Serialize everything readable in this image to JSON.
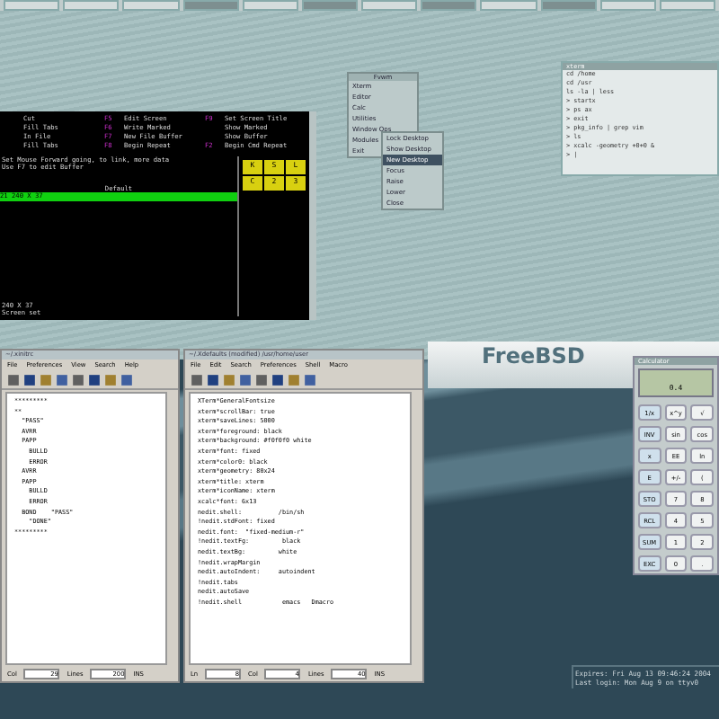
{
  "taskbar": {
    "buttons": [
      {
        "selected": false
      },
      {
        "selected": false
      },
      {
        "selected": false
      },
      {
        "selected": true
      },
      {
        "selected": false
      },
      {
        "selected": true
      },
      {
        "selected": false
      },
      {
        "selected": true
      },
      {
        "selected": false
      },
      {
        "selected": true
      },
      {
        "selected": false
      },
      {
        "selected": false
      }
    ]
  },
  "terminal": {
    "function_keys": [
      {
        "label": "Cut"
      },
      {
        "key": "F5",
        "label": "Edit Screen"
      },
      {
        "key": "F9",
        "label": "Set Screen Title"
      },
      {
        "label": "Fill Tabs"
      },
      {
        "key": "F6",
        "label": "Write Marked"
      },
      {
        "label": "Show Marked"
      },
      {
        "label": "In File"
      },
      {
        "key": "F7",
        "label": "New File Buffer"
      },
      {
        "label": "Show Buffer"
      },
      {
        "label": "Fill Tabs"
      },
      {
        "key": "F8",
        "label": "Begin Repeat"
      },
      {
        "key": "F2",
        "label": "Begin Cmd Repeat"
      }
    ],
    "lines": [
      "Set Mouse Forward going, to link, more data",
      "Use F7 to edit Buffer"
    ],
    "bar_title": "Default",
    "bar_text": "21 240 X 37",
    "footer": [
      "240 X 37",
      "  Screen set"
    ],
    "side_keys": [
      {
        "label": "K",
        "on": true
      },
      {
        "label": "S",
        "on": true
      },
      {
        "label": "L",
        "on": true
      },
      {
        "label": "C",
        "on": true
      },
      {
        "label": "2",
        "on": true
      },
      {
        "label": "3",
        "on": true
      }
    ]
  },
  "menu": {
    "title": "Fvwm",
    "items": [
      {
        "label": "Xterm",
        "selected": false
      },
      {
        "label": "Editor",
        "selected": false
      },
      {
        "label": "Calc",
        "selected": false
      },
      {
        "label": "Utilities",
        "selected": false
      },
      {
        "label": "Window Ops",
        "selected": false
      },
      {
        "label": "Modules",
        "selected": false
      },
      {
        "label": "Exit",
        "selected": false
      }
    ]
  },
  "submenu": {
    "items": [
      {
        "label": "Lock Desktop",
        "selected": false
      },
      {
        "label": "Show Desktop",
        "selected": false
      },
      {
        "label": "New Desktop",
        "selected": true
      },
      {
        "label": "Focus",
        "selected": false
      },
      {
        "label": "Raise",
        "selected": false
      },
      {
        "label": "Lower",
        "selected": false
      },
      {
        "label": "Close",
        "selected": false
      }
    ]
  },
  "xterm": {
    "title": "xterm",
    "lines": [
      "cd /home",
      "cd /usr",
      "ls -la | less",
      "> startx",
      "> ps ax",
      "> exit",
      "> pkg_info | grep vim",
      "> ls",
      "> xcalc -geometry +0+0 &",
      "> |"
    ]
  },
  "editor_left": {
    "title": "~/.xinitrc",
    "menu": [
      "File",
      "Preferences",
      "View",
      "Search",
      "Help"
    ],
    "lines": [
      "*********",
      "**",
      "  \"PASS\"",
      "  AVRR",
      "  PAPP",
      "    BULLD",
      "    ERROR",
      "  AVRR",
      "  PAPP",
      "    BULLD",
      "    ERROR",
      "  BOND    \"PASS\"",
      "    \"DONE\"",
      "*********"
    ],
    "status": [
      {
        "label": "Col",
        "value": "29"
      },
      {
        "label": "Lines",
        "value": "200"
      }
    ],
    "mode": "INS"
  },
  "editor_main": {
    "title": "~/.Xdefaults (modified)   /usr/home/user",
    "menu": [
      "File",
      "Edit",
      "Search",
      "Preferences",
      "Shell",
      "Macro"
    ],
    "lines": [
      "XTerm*GeneralFontsize",
      "xterm*scrollBar: true",
      "xterm*saveLines: 5000",
      "xterm*foreground: black",
      "xterm*background: #f0f0f0 white",
      "xterm*font: fixed",
      "xterm*color0: black",
      "xterm*geometry: 80x24",
      "xterm*title: xterm",
      "xterm*iconName: xterm",
      "xcalc*font: 6x13",
      "nedit.shell:          /bin/sh",
      "!nedit.stdFont: fixed",
      "nedit.font:  \"fixed-medium-r\"",
      "!nedit.textFg:         black",
      "nedit.textBg:         white",
      "!nedit.wrapMargin",
      "nedit.autoIndent:     autoindent",
      "!nedit.tabs",
      "nedit.autoSave",
      "!nedit.shell           emacs   Dmacro"
    ],
    "status": [
      {
        "label": "Ln",
        "value": "8"
      },
      {
        "label": "Col",
        "value": "4"
      },
      {
        "label": "Lines",
        "value": "40"
      }
    ],
    "mode": "INS"
  },
  "logo": "FreeBSD",
  "calculator": {
    "title": "Calculator",
    "display": "0.4",
    "keys": [
      [
        "1/x",
        "x^y",
        "√"
      ],
      [
        "INV",
        "sin",
        "cos"
      ],
      [
        "x",
        "EE",
        "ln"
      ],
      [
        "E",
        "+/-",
        "("
      ],
      [
        "STO",
        "7",
        "8"
      ],
      [
        "RCL",
        "4",
        "5"
      ],
      [
        "SUM",
        "1",
        "2"
      ],
      [
        "EXC",
        "0",
        "."
      ]
    ]
  },
  "console": [
    "Expires: Fri Aug 13 09:46:24 2004",
    "Last login: Mon Aug 9 on ttyv0"
  ]
}
